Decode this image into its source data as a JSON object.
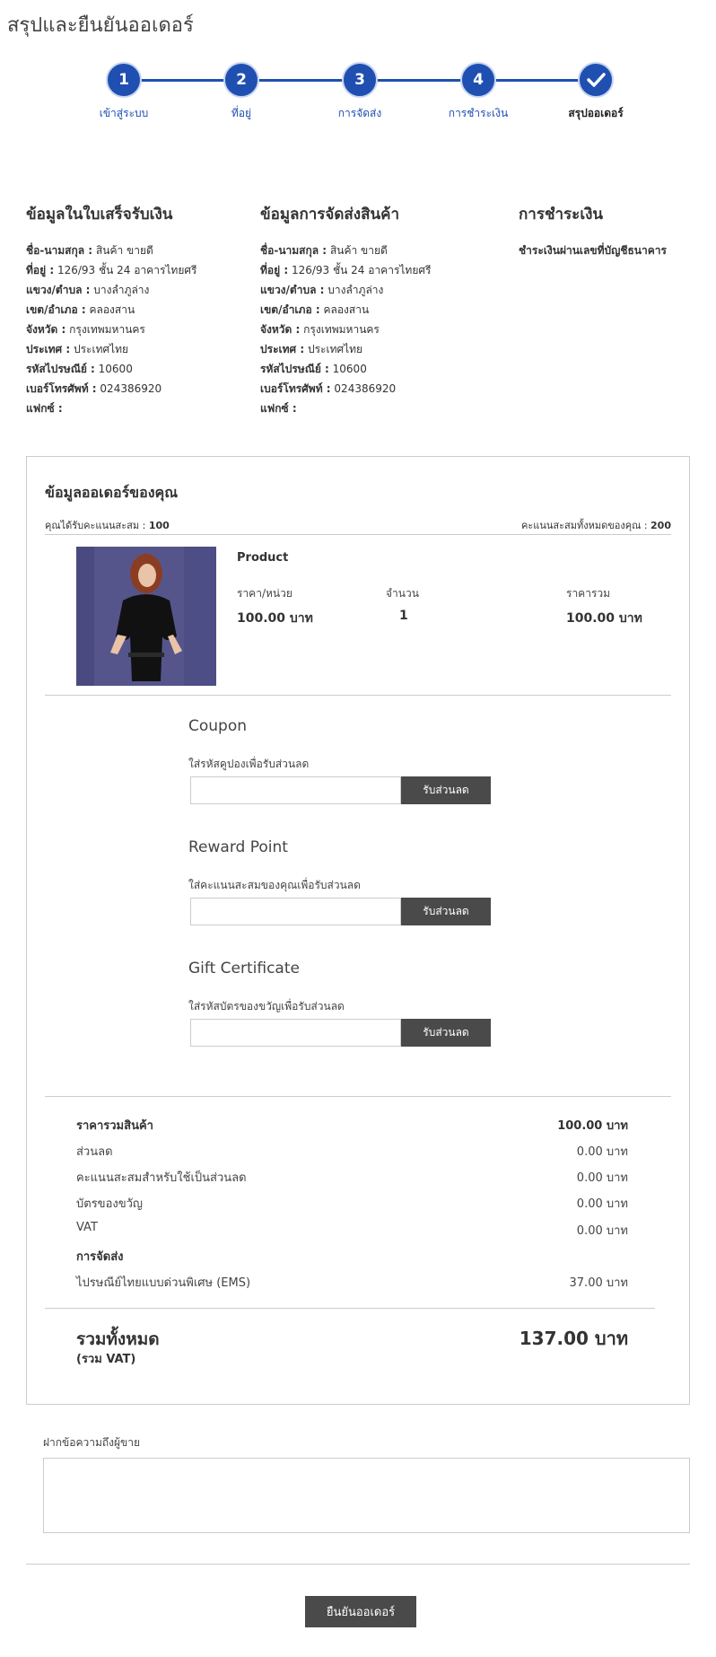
{
  "page": {
    "title": "สรุปและยืนยันออเดอร์"
  },
  "stepper": {
    "steps": [
      {
        "number": "1",
        "label": "เข้าสู่ระบบ"
      },
      {
        "number": "2",
        "label": "ที่อยู่"
      },
      {
        "number": "3",
        "label": "การจัดส่ง"
      },
      {
        "number": "4",
        "label": "การชำระเงิน"
      },
      {
        "number": "",
        "label": "สรุปออเดอร์"
      }
    ],
    "color": "#1f4fb1"
  },
  "billing": {
    "heading": "ข้อมูลในใบเสร็จรับเงิน",
    "lines": [
      {
        "label": "ชื่อ-นามสกุล :",
        "value": "สินค้า ขายดี"
      },
      {
        "label": "ที่อยู่ :",
        "value": "126/93 ชั้น 24 อาคารไทยศรี"
      },
      {
        "label": "แขวง/ตำบล :",
        "value": "บางลำภูล่าง"
      },
      {
        "label": "เขต/อำเภอ :",
        "value": "คลองสาน"
      },
      {
        "label": "จังหวัด :",
        "value": "กรุงเทพมหานคร"
      },
      {
        "label": "ประเทศ :",
        "value": "ประเทศไทย"
      },
      {
        "label": "รหัสไปรษณีย์ :",
        "value": "10600"
      },
      {
        "label": "เบอร์โทรศัพท์ :",
        "value": "024386920"
      },
      {
        "label": "แฟกซ์ :",
        "value": ""
      }
    ]
  },
  "shipping": {
    "heading": "ข้อมูลการจัดส่งสินค้า",
    "lines": [
      {
        "label": "ชื่อ-นามสกุล :",
        "value": "สินค้า ขายดี"
      },
      {
        "label": "ที่อยู่ :",
        "value": "126/93 ชั้น 24 อาคารไทยศรี"
      },
      {
        "label": "แขวง/ตำบล :",
        "value": "บางลำภูล่าง"
      },
      {
        "label": "เขต/อำเภอ :",
        "value": "คลองสาน"
      },
      {
        "label": "จังหวัด :",
        "value": "กรุงเทพมหานคร"
      },
      {
        "label": "ประเทศ :",
        "value": "ประเทศไทย"
      },
      {
        "label": "รหัสไปรษณีย์ :",
        "value": "10600"
      },
      {
        "label": "เบอร์โทรศัพท์ :",
        "value": "024386920"
      },
      {
        "label": "แฟกซ์ :",
        "value": ""
      }
    ]
  },
  "payment": {
    "heading": "การชำระเงิน",
    "method": "ชำระเงินผ่านเลขที่บัญชีธนาคาร"
  },
  "order": {
    "title": "ข้อมูลออเดอร์ของคุณ",
    "points_earned_label": "คุณได้รับคะแนนสะสม :",
    "points_earned_value": "100",
    "points_total_label": "คะแนนสะสมทั้งหมดของคุณ :",
    "points_total_value": "200",
    "product": {
      "name": "Product",
      "unit_price_label": "ราคา/หน่วย",
      "quantity_label": "จำนวน",
      "subtotal_label": "ราคารวม",
      "unit_price": "100.00 บาท",
      "quantity": "1",
      "subtotal": "100.00 บาท"
    }
  },
  "discounts": {
    "coupon": {
      "title": "Coupon",
      "label": "ใส่รหัสคูปองเพื่อรับส่วนลด",
      "button": "รับส่วนลด",
      "placeholder": ""
    },
    "reward": {
      "title": "Reward Point",
      "label": "ใส่คะแนนสะสมของคุณเพื่อรับส่วนลด",
      "button": "รับส่วนลด",
      "placeholder": ""
    },
    "gift": {
      "title": "Gift Certificate",
      "label": "ใส่รหัสบัตรของขวัญเพื่อรับส่วนลด",
      "button": "รับส่วนลด",
      "placeholder": ""
    }
  },
  "summary": {
    "rows": [
      {
        "label": "ราคารวมสินค้า",
        "value": "100.00 บาท"
      },
      {
        "label": "ส่วนลด",
        "value": "0.00 บาท"
      },
      {
        "label": "คะแนนสะสมสำหรับใช้เป็นส่วนลด",
        "value": "0.00 บาท"
      },
      {
        "label": "บัตรของขวัญ",
        "value": "0.00 บาท"
      },
      {
        "label": "VAT",
        "value": "0.00 บาท"
      },
      {
        "label": "การจัดส่ง",
        "value": ""
      },
      {
        "label": "ไปรษณีย์ไทยแบบด่วนพิเศษ (EMS)",
        "value": "37.00 บาท"
      }
    ],
    "total_label": "รวมทั้งหมด",
    "total_sub": "(รวม VAT)",
    "total_value": "137.00 บาท"
  },
  "note": {
    "label": "ฝากข้อความถึงผู้ขาย",
    "placeholder": ""
  },
  "confirm": {
    "button": "ยืนยันออเดอร์"
  }
}
